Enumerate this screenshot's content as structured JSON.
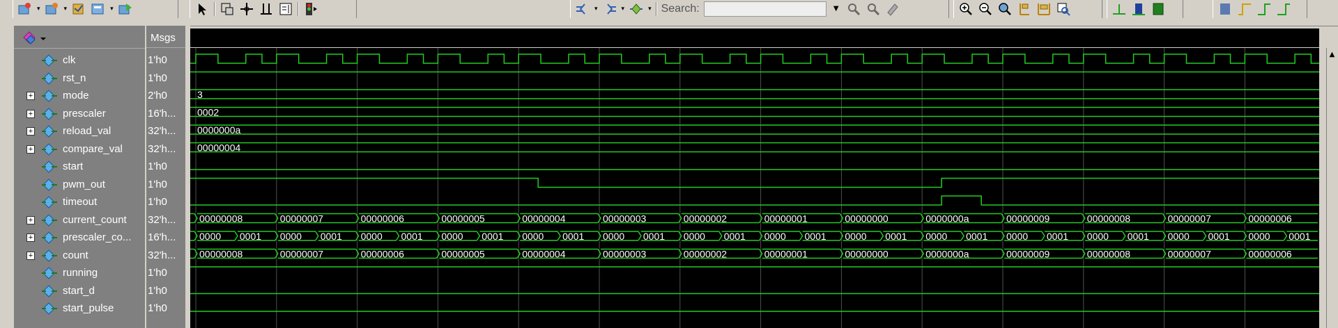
{
  "toolbar": {
    "search_label": "Search:"
  },
  "header": {
    "msgs_label": "Msgs"
  },
  "signals": [
    {
      "name": "clk",
      "value": "1'h0",
      "expandable": false
    },
    {
      "name": "rst_n",
      "value": "1'h0",
      "expandable": false
    },
    {
      "name": "mode",
      "value": "2'h0",
      "expandable": true
    },
    {
      "name": "prescaler",
      "value": "16'h...",
      "expandable": true
    },
    {
      "name": "reload_val",
      "value": "32'h...",
      "expandable": true
    },
    {
      "name": "compare_val",
      "value": "32'h...",
      "expandable": true
    },
    {
      "name": "start",
      "value": "1'h0",
      "expandable": false
    },
    {
      "name": "pwm_out",
      "value": "1'h0",
      "expandable": false
    },
    {
      "name": "timeout",
      "value": "1'h0",
      "expandable": false
    },
    {
      "name": "current_count",
      "value": "32'h...",
      "expandable": true
    },
    {
      "name": "prescaler_co...",
      "value": "16'h...",
      "expandable": true
    },
    {
      "name": "count",
      "value": "32'h...",
      "expandable": true
    },
    {
      "name": "running",
      "value": "1'h0",
      "expandable": false
    },
    {
      "name": "start_d",
      "value": "1'h0",
      "expandable": false
    },
    {
      "name": "start_pulse",
      "value": "1'h0",
      "expandable": false
    }
  ],
  "bus_values": {
    "mode": [
      "3"
    ],
    "prescaler": [
      "0002"
    ],
    "reload_val": [
      "0000000a"
    ],
    "compare_val": [
      "00000004"
    ],
    "current_count": [
      "00000008",
      "00000007",
      "00000006",
      "00000005",
      "00000004",
      "00000003",
      "00000002",
      "00000001",
      "00000000",
      "0000000a",
      "00000009",
      "00000008",
      "00000007",
      "00000006"
    ],
    "prescaler_count": [
      "0000",
      "0001",
      "0000",
      "0001",
      "0000",
      "0001",
      "0000",
      "0001",
      "0000",
      "0001",
      "0000",
      "0001",
      "0000",
      "0001",
      "0000",
      "0001",
      "0000",
      "0001",
      "0000",
      "0001",
      "0000",
      "0001",
      "0000",
      "0001",
      "0000",
      "0001",
      "0000",
      "0001"
    ],
    "count": [
      "00000008",
      "00000007",
      "00000006",
      "00000005",
      "00000004",
      "00000003",
      "00000002",
      "00000001",
      "00000000",
      "0000000a",
      "00000009",
      "00000008",
      "00000007",
      "00000006"
    ]
  },
  "colors": {
    "wave": "#22cc22",
    "background": "#000000",
    "grid": "#505050",
    "text": "#ffffff"
  },
  "icons": [
    "open-icon",
    "save-icon",
    "compile-icon",
    "simulate-icon",
    "cursor-icon",
    "zoom-region-icon",
    "move-icon",
    "insert-cursor-icon",
    "edit-icon",
    "traffic-light-icon",
    "find-previous-icon",
    "find-next-icon",
    "search-icon",
    "zoom-in-icon",
    "zoom-out-icon",
    "zoom-full-icon",
    "zoom-cursor-icon"
  ]
}
